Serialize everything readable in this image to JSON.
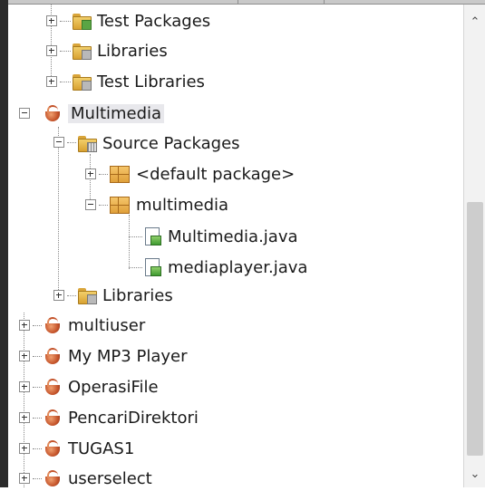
{
  "tree": {
    "items": [
      {
        "label": "Test Packages"
      },
      {
        "label": "Libraries"
      },
      {
        "label": "Test Libraries"
      },
      {
        "label": "Multimedia"
      },
      {
        "label": "Source Packages"
      },
      {
        "label": "<default package>"
      },
      {
        "label": "multimedia"
      },
      {
        "label": "Multimedia.java"
      },
      {
        "label": "mediaplayer.java"
      },
      {
        "label": "Libraries"
      },
      {
        "label": "multiuser"
      },
      {
        "label": "My MP3 Player"
      },
      {
        "label": "OperasiFile"
      },
      {
        "label": "PencariDirektori"
      },
      {
        "label": "TUGAS1"
      },
      {
        "label": "userselect"
      }
    ]
  },
  "scrollbar": {
    "up_glyph": "⌃",
    "down_glyph": "⌄"
  },
  "colors": {
    "selection": "#e8e8ec",
    "folder": "#f2cf6b",
    "project": "#c4532a",
    "package": "#e0a03a"
  }
}
